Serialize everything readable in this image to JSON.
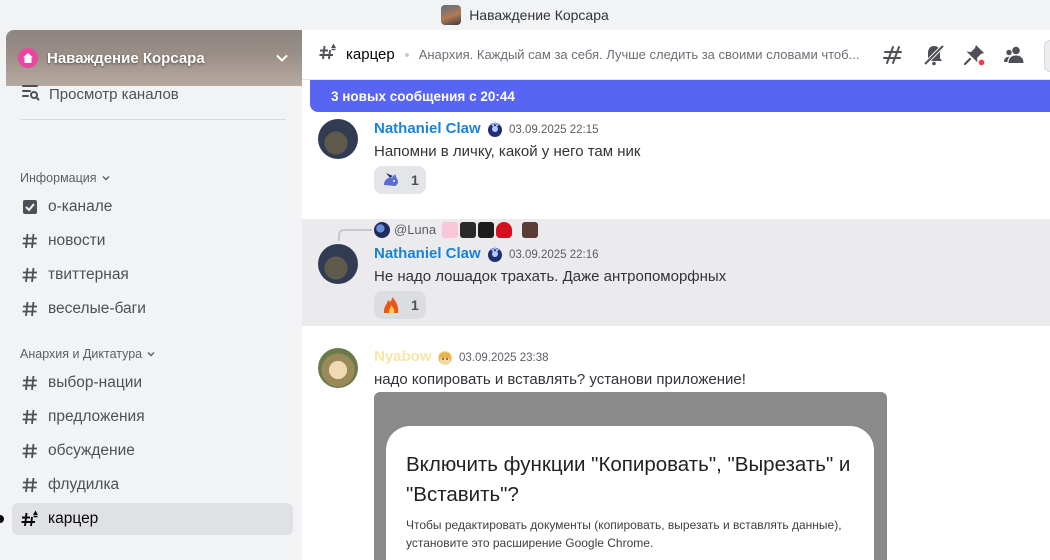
{
  "window": {
    "title": "Наваждение Корсара"
  },
  "server": {
    "name": "Наваждение Корсара"
  },
  "sidebar": {
    "browse_label": "Просмотр каналов",
    "categories": [
      {
        "name": "Информация",
        "channels": [
          "о-канале",
          "новости",
          "твиттерная",
          "веселые-баги"
        ]
      },
      {
        "name": "Анархия и Диктатура",
        "channels": [
          "выбор-нации",
          "предложения",
          "обсуждение",
          "флудилка",
          "карцер"
        ]
      }
    ],
    "active_channel": "карцер"
  },
  "header": {
    "channel": "карцер",
    "topic": "Анархия. Каждый сам за себя. Лучше следить за своими словами чтоб...",
    "icons": [
      "threads-icon",
      "mute-icon",
      "pin-icon",
      "members-icon"
    ],
    "pin_alert_color": "#f23f43"
  },
  "new_messages_bar": {
    "text": "3 новых сообщения с 20:44",
    "color": "#5865f2"
  },
  "messages": [
    {
      "author": "Nathaniel Claw",
      "author_color": "#1b83d6",
      "timestamp": "03.09.2025 22:15",
      "text": "Напомни в личку, какой у него там ник",
      "reaction": {
        "emoji": "pony-emoji",
        "count": "1"
      }
    },
    {
      "reply_to": "@Luna",
      "author": "Nathaniel Claw",
      "author_color": "#1b83d6",
      "timestamp": "03.09.2025 22:16",
      "text": "Не надо лошадок трахать. Даже антропоморфных",
      "reaction": {
        "emoji": "fire-figure-emoji",
        "count": "1"
      }
    },
    {
      "author": "Nyabow",
      "author_color": "#f5e7a6",
      "timestamp": "03.09.2025 23:38",
      "text": "надо копировать и вставлять? установи приложение!",
      "embed": {
        "title": "Включить функции \"Копировать\", \"Вырезать\" и \"Вставить\"?",
        "body": "Чтобы редактировать документы (копировать, вырезать и вставлять данные), установите это расширение Google Chrome."
      }
    }
  ]
}
